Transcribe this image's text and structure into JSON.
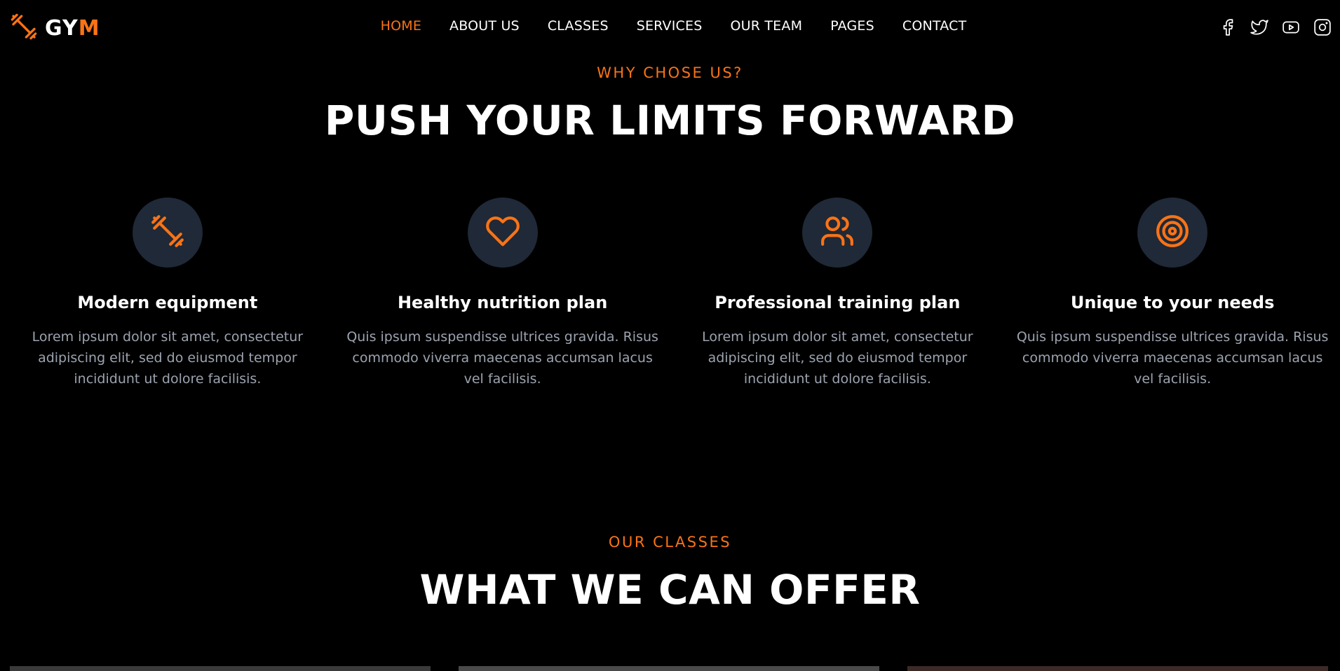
{
  "brand": {
    "prefix": "GY",
    "suffix": "M"
  },
  "nav": [
    {
      "label": "HOME",
      "active": true
    },
    {
      "label": "ABOUT US"
    },
    {
      "label": "CLASSES"
    },
    {
      "label": "SERVICES"
    },
    {
      "label": "OUR TEAM"
    },
    {
      "label": "PAGES"
    },
    {
      "label": "CONTACT"
    }
  ],
  "socials": [
    "facebook-icon",
    "twitter-icon",
    "youtube-icon",
    "instagram-icon"
  ],
  "why": {
    "eyebrow": "WHY CHOSE US?",
    "heading": "PUSH YOUR LIMITS FORWARD",
    "features": [
      {
        "icon": "dumbbell-icon",
        "title": "Modern equipment",
        "desc": "Lorem ipsum dolor sit amet, consectetur adipiscing elit, sed do eiusmod tempor incididunt ut dolore facilisis."
      },
      {
        "icon": "heart-icon",
        "title": "Healthy nutrition plan",
        "desc": "Quis ipsum suspendisse ultrices gravida. Risus commodo viverra maecenas accumsan lacus vel facilisis."
      },
      {
        "icon": "users-icon",
        "title": "Professional training plan",
        "desc": "Lorem ipsum dolor sit amet, consectetur adipiscing elit, sed do eiusmod tempor incididunt ut dolore facilisis."
      },
      {
        "icon": "target-icon",
        "title": "Unique to your needs",
        "desc": "Quis ipsum suspendisse ultrices gravida. Risus commodo viverra maecenas accumsan lacus vel facilisis."
      }
    ]
  },
  "classes": {
    "eyebrow": "OUR CLASSES",
    "heading": "WHAT WE CAN OFFER"
  },
  "colors": {
    "accent": "#f97316",
    "background": "#000000",
    "circle": "#1f2937",
    "muted": "#9ca3af"
  }
}
